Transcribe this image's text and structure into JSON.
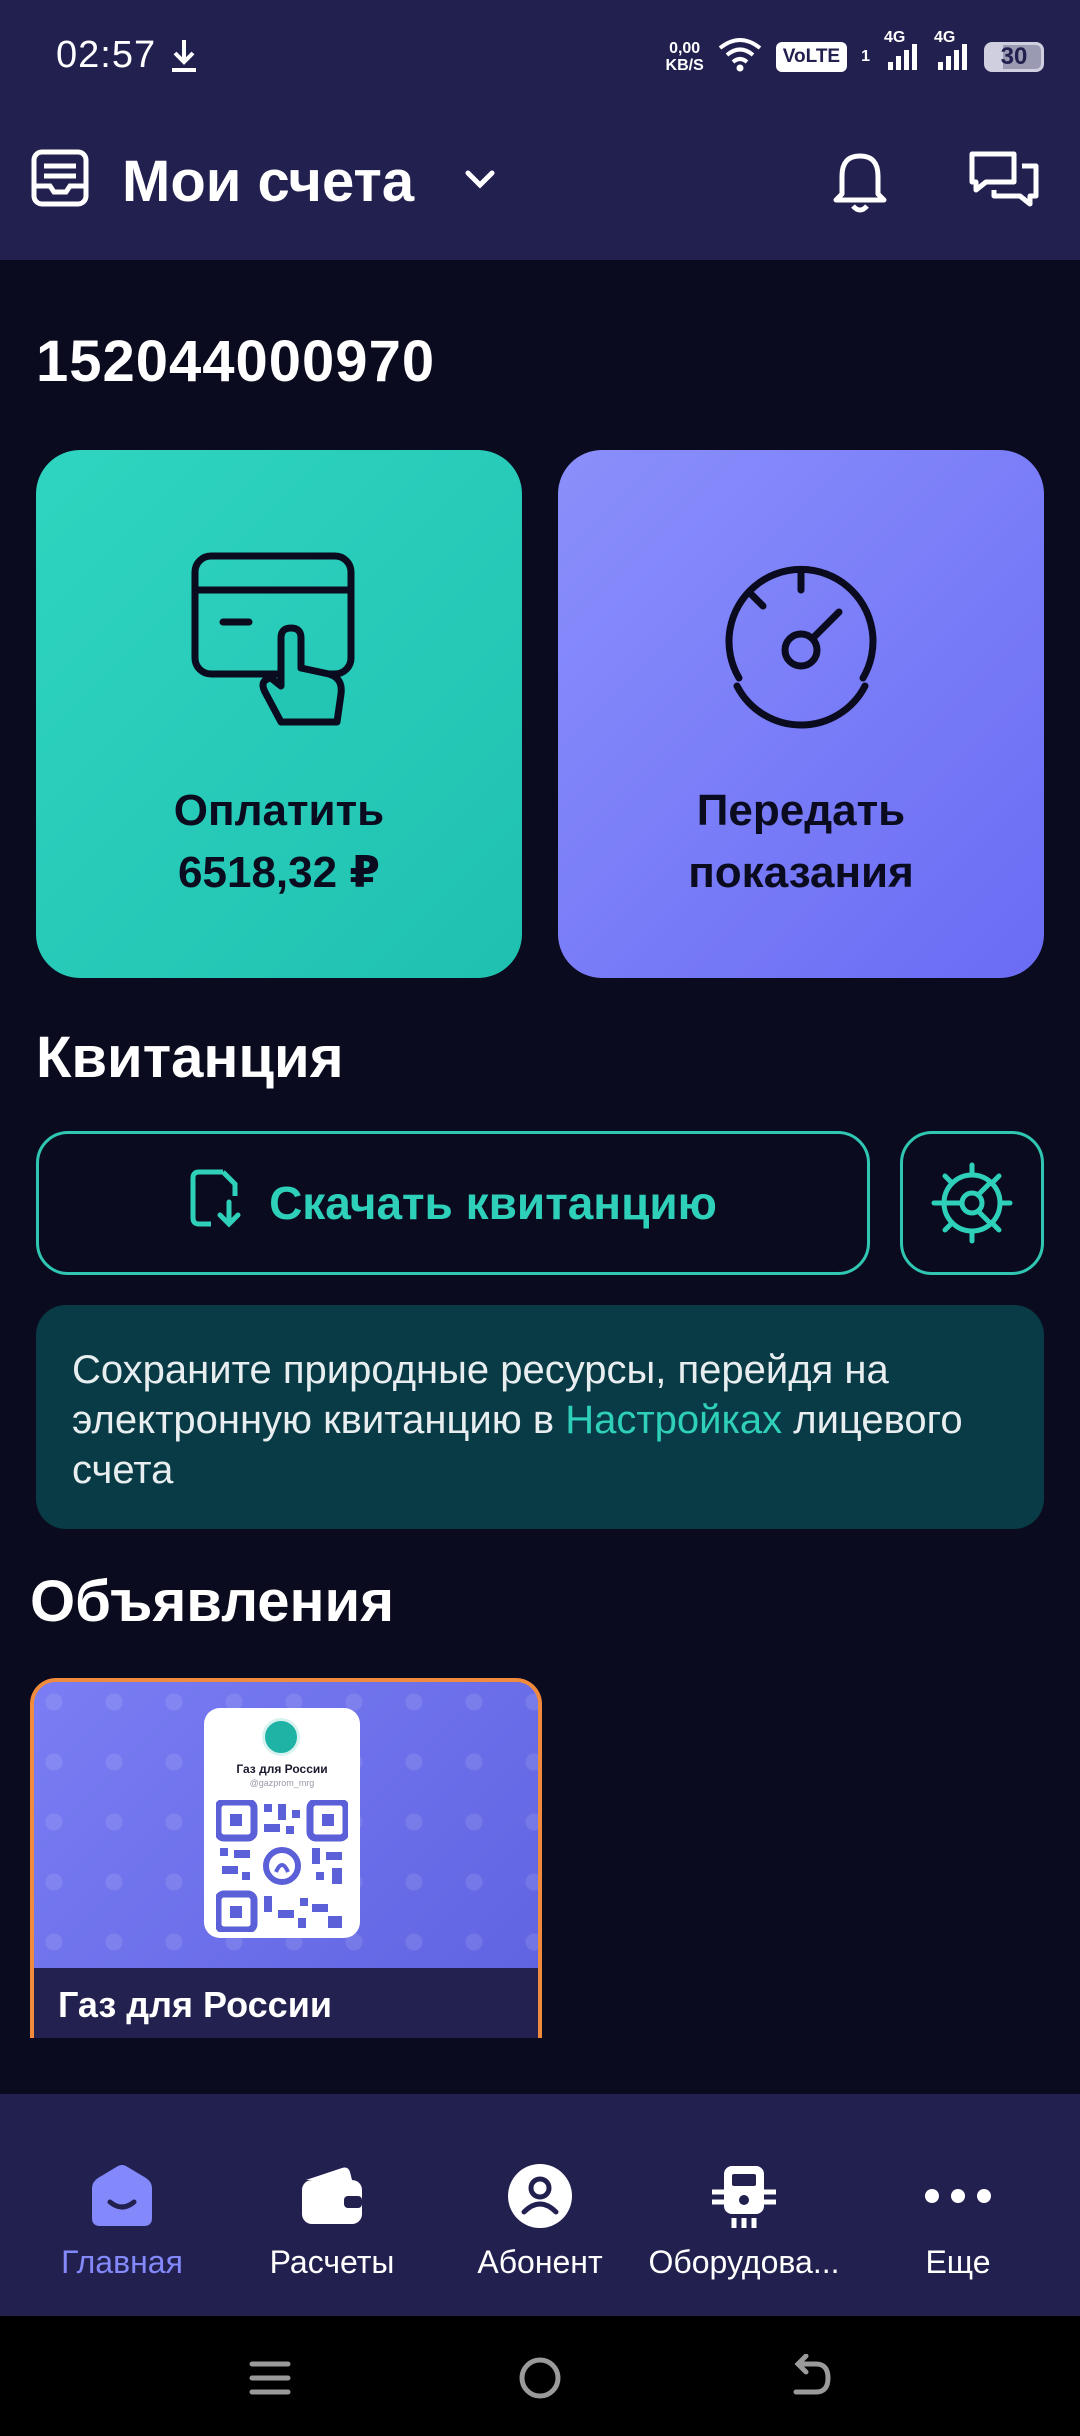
{
  "status_bar": {
    "time": "02:57",
    "speed_value": "0,00",
    "speed_unit": "KB/S",
    "volte": "VoLTE",
    "sim1": "1",
    "net1": "4G",
    "net2": "4G",
    "battery": "30"
  },
  "header": {
    "title": "Мои счета"
  },
  "account": {
    "number": "152044000970"
  },
  "tiles": {
    "pay_line1": "Оплатить",
    "pay_line2": "6518,32 ₽",
    "meter_line1": "Передать",
    "meter_line2": "показания"
  },
  "receipt": {
    "title": "Квитанция",
    "download_label": "Скачать квитанцию",
    "notice_text": "Сохраните природные ресурсы, перейдя на электронную квитанцию в ",
    "notice_link": "Настройках",
    "notice_tail": " лицевого счета"
  },
  "announcements": {
    "title": "Объявления",
    "card_caption": "Газ для России",
    "qr_title": "Газ для России",
    "qr_handle": "@gazprom_mrg"
  },
  "bottom_nav": {
    "items": [
      {
        "label": "Главная",
        "active": true
      },
      {
        "label": "Расчеты",
        "active": false
      },
      {
        "label": "Абонент",
        "active": false
      },
      {
        "label": "Оборудова...",
        "active": false
      },
      {
        "label": "Еще",
        "active": false
      }
    ]
  },
  "colors": {
    "accent_teal": "#2fd0ba",
    "accent_violet": "#8388fa",
    "header_bg": "#22204f",
    "page_bg": "#0b0b1f"
  }
}
